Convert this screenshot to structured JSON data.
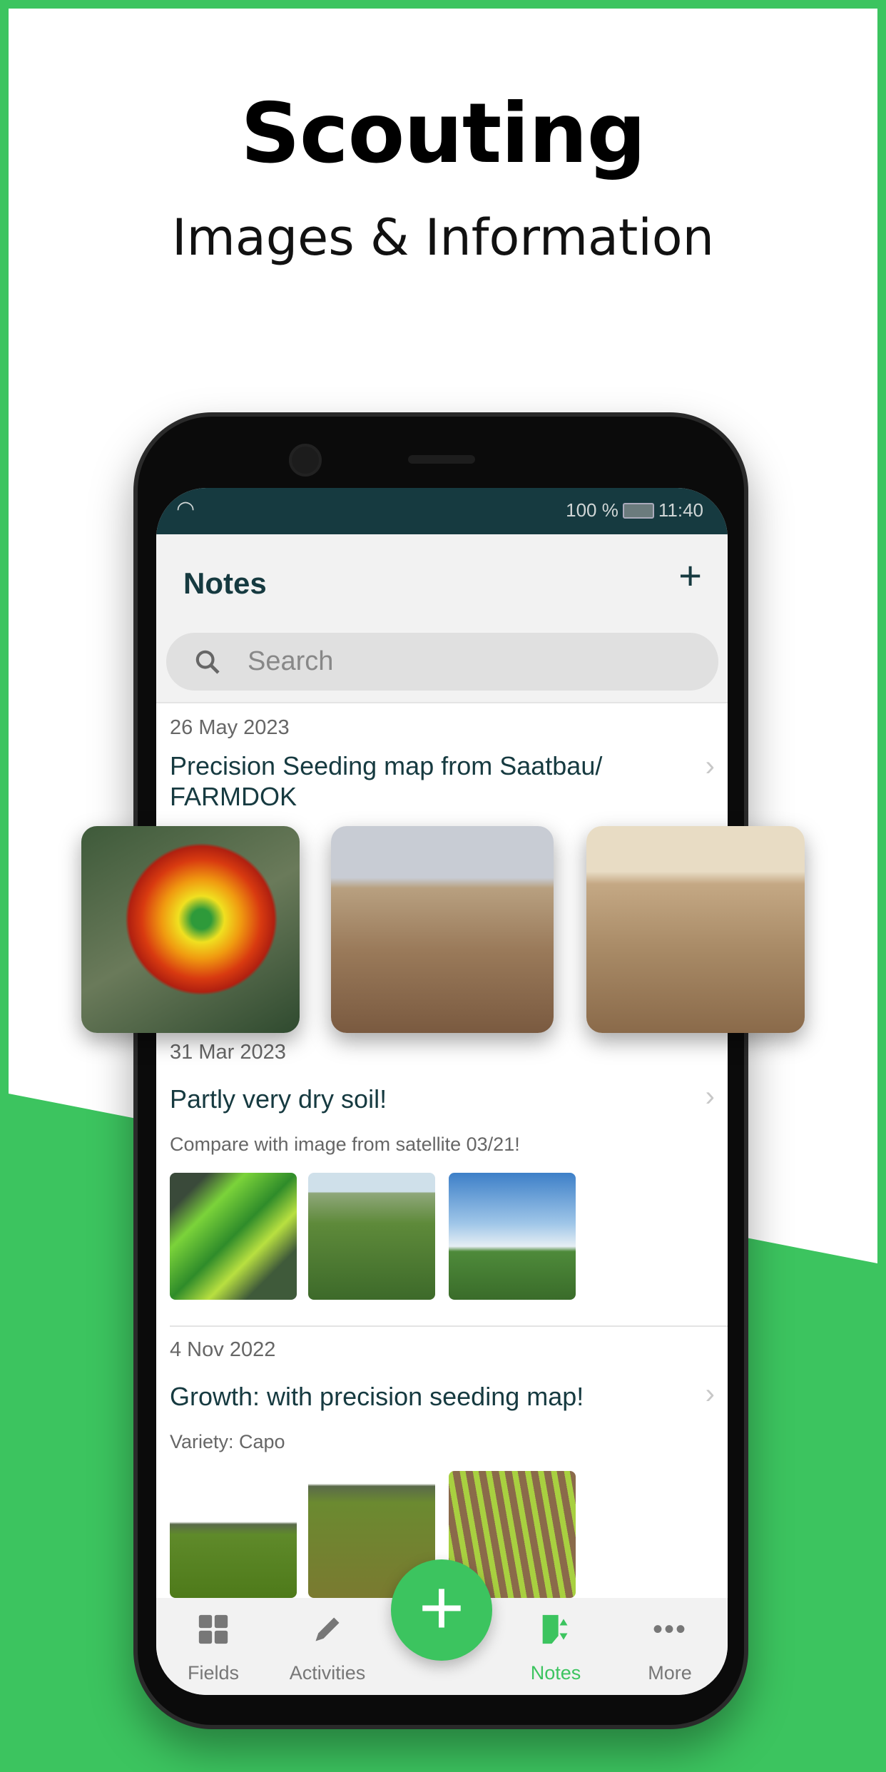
{
  "promo": {
    "title": "Scouting",
    "subtitle": "Images & Information"
  },
  "status_bar": {
    "battery": "100 %",
    "time": "11:40"
  },
  "header": {
    "title": "Notes",
    "add_icon": "plus-icon"
  },
  "search": {
    "placeholder": "Search"
  },
  "notes": [
    {
      "date": "26 May 2023",
      "title": "Precision Seeding map from Saatbau/ FARMDOK",
      "images": [
        "heatmap",
        "young-corn-row",
        "young-corn-row-closeup"
      ]
    },
    {
      "date": "31 Mar 2023",
      "title": "Partly very dry soil!",
      "subtitle": "Compare with image from satellite 03/21!",
      "images": [
        "satellite-map",
        "wheat-field",
        "field-sky"
      ]
    },
    {
      "date": "4 Nov 2022",
      "title": "Growth: with precision seeding map!",
      "subtitle": "Variety: Capo",
      "images": [
        "green-field",
        "seeded-rows",
        "corn-rows"
      ]
    }
  ],
  "nav": {
    "items": [
      {
        "label": "Fields",
        "icon": "grid-icon"
      },
      {
        "label": "Activities",
        "icon": "pencil-icon"
      },
      {
        "label": "Notes",
        "icon": "notes-icon",
        "active": true
      },
      {
        "label": "More",
        "icon": "more-icon"
      }
    ]
  },
  "colors": {
    "accent": "#3cc45f",
    "dark": "#163a40"
  }
}
